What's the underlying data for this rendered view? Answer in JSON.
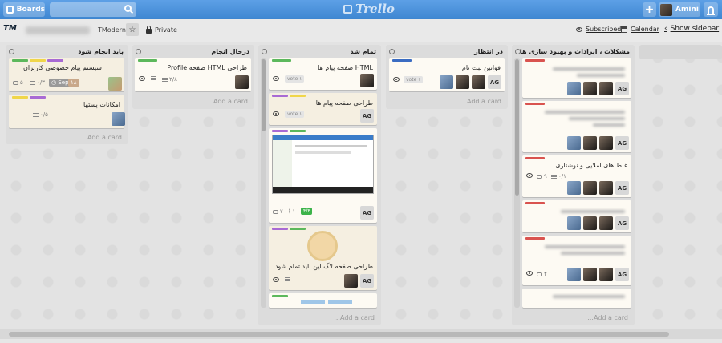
{
  "header": {
    "boards_label": "Boards",
    "search_placeholder": "",
    "logo_text": "Trello",
    "add_label": "+",
    "user_name": "Amini"
  },
  "board_bar": {
    "org_icon_text": "TM",
    "org_name": "TModern",
    "star": "☆",
    "privacy": "Private",
    "subscribed": "Subscribed",
    "calendar": "Calendar",
    "show_sidebar": "Show sidebar"
  },
  "colors": {
    "topbar": "#3e86d1",
    "label_green": "#5cb85c",
    "label_yellow": "#f0d64a",
    "label_purple": "#a86ad4",
    "label_blue": "#3a6cc2",
    "label_red": "#d9534f",
    "check_green": "#3cb34a"
  },
  "lists": [
    {
      "title": "باید انجام شود",
      "add_card": "Add a card...",
      "cards": [
        {
          "title": "سیستم پیام خصوصی کاربران",
          "comments": "۵",
          "checklist": "۰/۳",
          "due": "Sep 1",
          "due_badge": "۱۸"
        },
        {
          "title": "امکانات پستها",
          "checklist": "۰/۵"
        }
      ]
    },
    {
      "title": "درحال انجام",
      "add_card": "Add a card...",
      "cards": [
        {
          "title": "طراحی HTML صفحه Profile",
          "checklist": "۲/۸"
        }
      ]
    },
    {
      "title": "تمام شد",
      "add_card": "Add a card...",
      "cards": [
        {
          "title": "HTML صفحه پیام ها",
          "vote": "vote ۱"
        },
        {
          "title": "طراحی صفحه پیام ها",
          "vote": "vote ۱",
          "member": "AG"
        },
        {
          "title": "",
          "comments": "۷",
          "attachments": "۱",
          "checklist": "۴/۴",
          "member": "AG"
        },
        {
          "title": "طراحی صفحه لاگ این باید تمام شود",
          "member": "AG"
        },
        {
          "title": ""
        }
      ]
    },
    {
      "title": "در انتظار",
      "add_card": "Add a card...",
      "cards": [
        {
          "title": "فوانین ثبت نام",
          "vote": "vote ۱",
          "member": "AG"
        }
      ]
    },
    {
      "title": "مشکلات ، ایرادات و بهبود سازی ها",
      "add_card": "Add a card...",
      "cards": [
        {
          "title": "",
          "member": "AG"
        },
        {
          "title": "",
          "member": "AG"
        },
        {
          "title": "غلط های املایی و نوشتاری",
          "comments": "۹",
          "checklist": "۰/۱",
          "member": "AG"
        },
        {
          "title": "",
          "member": "AG"
        },
        {
          "title": "",
          "comments": "۴",
          "member": "AG"
        },
        {
          "title": ""
        }
      ]
    }
  ]
}
